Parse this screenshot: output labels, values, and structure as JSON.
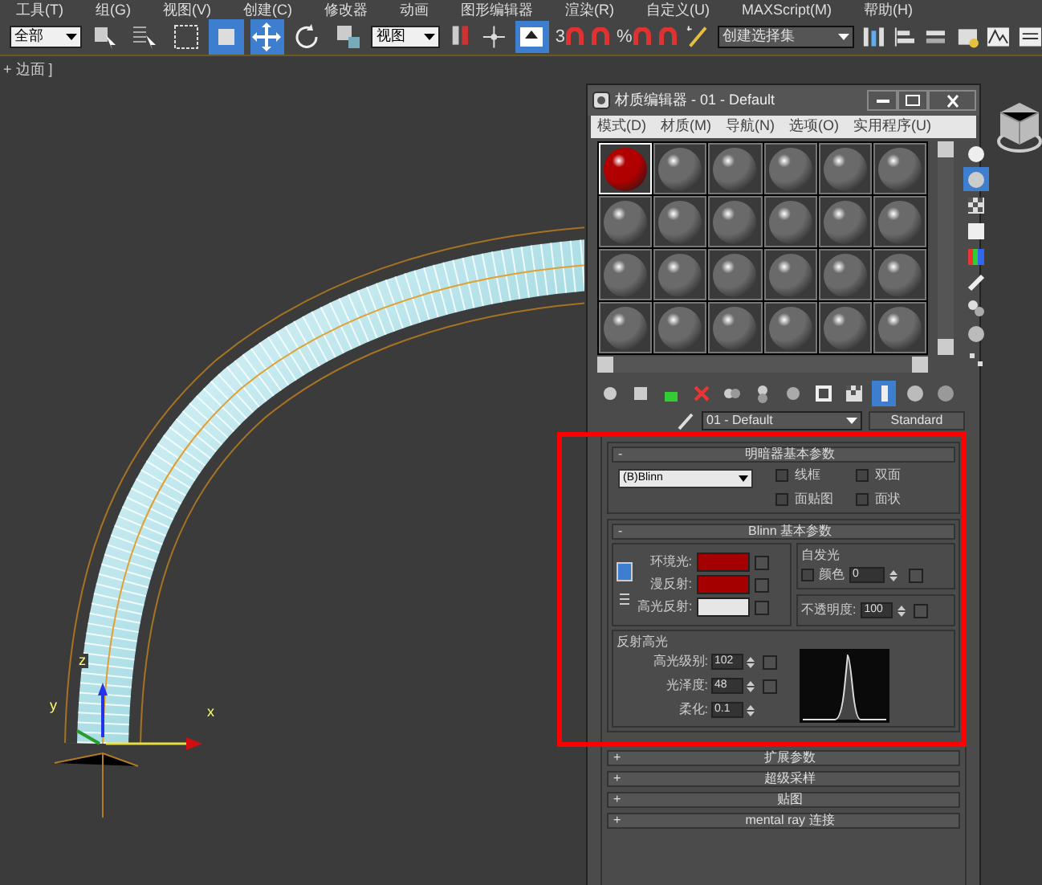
{
  "menu_bar": [
    {
      "label": "工具(T)"
    },
    {
      "label": "组(G)"
    },
    {
      "label": "视图(V)"
    },
    {
      "label": "创建(C)"
    },
    {
      "label": "修改器"
    },
    {
      "label": "动画"
    },
    {
      "label": "图形编辑器"
    },
    {
      "label": "渲染(R)"
    },
    {
      "label": "自定义(U)"
    },
    {
      "label": "MAXScript(M)"
    },
    {
      "label": "帮助(H)"
    }
  ],
  "toolbar": {
    "selection_filter": "全部",
    "reference_coord": "视图",
    "selection_set": "创建选择集",
    "snap_3d": "3",
    "percent_snap": "%",
    "tools": [
      {
        "kind": "select",
        "selected": false
      },
      {
        "kind": "select-by-name",
        "selected": false
      },
      {
        "kind": "region",
        "selected": false
      },
      {
        "kind": "window",
        "selected": true
      },
      {
        "kind": "move",
        "selected": true
      },
      {
        "kind": "rotate",
        "selected": false
      },
      {
        "kind": "scale",
        "selected": false
      }
    ]
  },
  "viewport": {
    "label": "+ 边面 ]",
    "axes": [
      "z",
      "y",
      "x"
    ]
  },
  "material_editor": {
    "title": "材质编辑器 - 01 - Default",
    "menu": [
      {
        "label": "模式(D)"
      },
      {
        "label": "材质(M)"
      },
      {
        "label": "导航(N)"
      },
      {
        "label": "选项(O)"
      },
      {
        "label": "实用程序(U)"
      }
    ],
    "slots": [
      {
        "color": "#b00000",
        "selected": true
      },
      {
        "color": "#6a6a6a",
        "selected": false
      },
      {
        "color": "#6a6a6a",
        "selected": false
      },
      {
        "color": "#6a6a6a",
        "selected": false
      },
      {
        "color": "#6a6a6a",
        "selected": false
      },
      {
        "color": "#6a6a6a",
        "selected": false
      },
      {
        "color": "#6a6a6a",
        "selected": false
      },
      {
        "color": "#6a6a6a",
        "selected": false
      },
      {
        "color": "#6a6a6a",
        "selected": false
      },
      {
        "color": "#6a6a6a",
        "selected": false
      },
      {
        "color": "#6a6a6a",
        "selected": false
      },
      {
        "color": "#6a6a6a",
        "selected": false
      },
      {
        "color": "#6a6a6a",
        "selected": false
      },
      {
        "color": "#6a6a6a",
        "selected": false
      },
      {
        "color": "#6a6a6a",
        "selected": false
      },
      {
        "color": "#6a6a6a",
        "selected": false
      },
      {
        "color": "#6a6a6a",
        "selected": false
      },
      {
        "color": "#6a6a6a",
        "selected": false
      },
      {
        "color": "#6a6a6a",
        "selected": false
      },
      {
        "color": "#6a6a6a",
        "selected": false
      },
      {
        "color": "#6a6a6a",
        "selected": false
      },
      {
        "color": "#6a6a6a",
        "selected": false
      },
      {
        "color": "#6a6a6a",
        "selected": false
      },
      {
        "color": "#6a6a6a",
        "selected": false
      }
    ],
    "side_tools": [
      {
        "selected": false
      },
      {
        "selected": true
      },
      {
        "selected": false
      },
      {
        "selected": false
      },
      {
        "selected": false
      },
      {
        "selected": false
      },
      {
        "selected": false
      },
      {
        "selected": false
      },
      {
        "selected": false
      }
    ],
    "bottom_tools": [
      {
        "selected": false
      },
      {
        "selected": false
      },
      {
        "selected": false
      },
      {
        "selected": false
      },
      {
        "selected": false
      },
      {
        "selected": false
      },
      {
        "selected": false
      },
      {
        "selected": false
      },
      {
        "selected": false
      },
      {
        "selected": true
      },
      {
        "selected": false
      },
      {
        "selected": false
      }
    ],
    "material_name": "01 - Default",
    "material_type": "Standard",
    "shader": {
      "sign": "-",
      "title": "明暗器基本参数",
      "dropdown": "(B)Blinn",
      "options": [
        {
          "label": "线框",
          "checked": false
        },
        {
          "label": "双面",
          "checked": false
        },
        {
          "label": "面贴图",
          "checked": false
        },
        {
          "label": "面状",
          "checked": false
        }
      ]
    },
    "basic": {
      "sign": "-",
      "title": "Blinn 基本参数",
      "colors": [
        {
          "label": "环境光:",
          "color": "#a50000"
        },
        {
          "label": "漫反射:",
          "color": "#a50000"
        },
        {
          "label": "高光反射:",
          "color": "#e6e6e6"
        }
      ],
      "self_illum": {
        "title": "自发光",
        "label": "颜色",
        "checked": false,
        "value": "0"
      },
      "opacity": {
        "label": "不透明度:",
        "value": "100"
      },
      "specular": {
        "title": "反射高光",
        "fields": [
          {
            "label": "高光级别:",
            "value": "102"
          },
          {
            "label": "光泽度:",
            "value": "48"
          },
          {
            "label": "柔化:",
            "value": "0.1"
          }
        ]
      }
    },
    "rollouts": [
      {
        "sign": "+",
        "label": "扩展参数"
      },
      {
        "sign": "+",
        "label": "超级采样"
      },
      {
        "sign": "+",
        "label": "贴图"
      },
      {
        "sign": "+",
        "label": "mental ray 连接"
      }
    ]
  }
}
